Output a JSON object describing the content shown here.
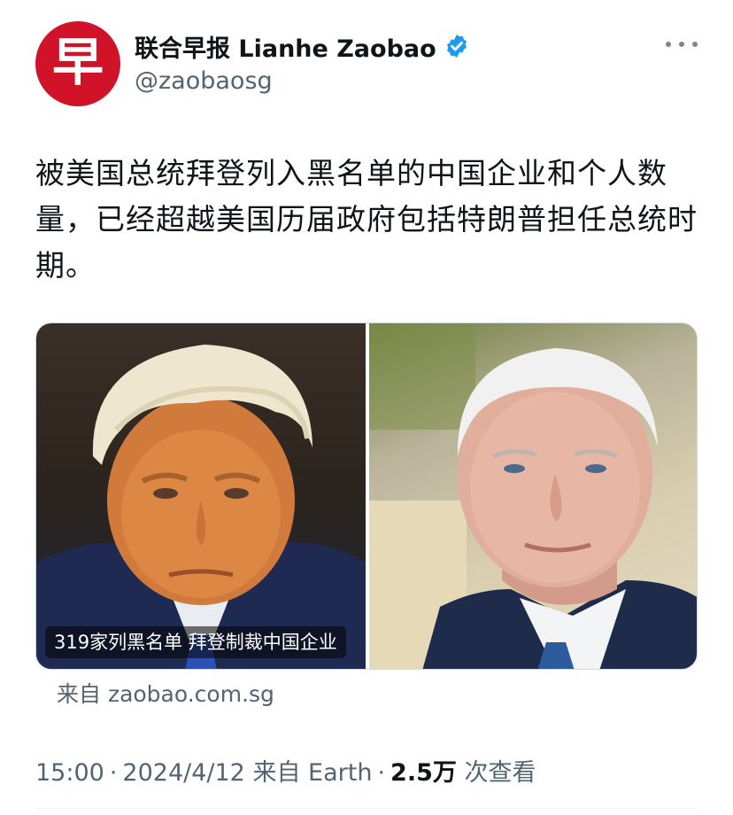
{
  "account": {
    "avatar_char": "早",
    "display_name": "联合早报 Lianhe Zaobao",
    "handle": "@zaobaosg",
    "verified_icon": "verified-badge-icon",
    "brand_color": "#d1132a",
    "verified_color": "#1d9bf0"
  },
  "tweet": {
    "text": "被美国总统拜登列入黑名单的中国企业和个人数量，已经超越美国历届政府包括特朗普担任总统时期。"
  },
  "link_card": {
    "caption": "319家列黑名单 拜登制裁中国企业",
    "source": "来自 zaobao.com.sg"
  },
  "meta": {
    "time": "15:00",
    "date": "2024/4/12",
    "via": "来自 Earth",
    "views_count": "2.5万",
    "views_label": "次查看",
    "separator": "·"
  }
}
